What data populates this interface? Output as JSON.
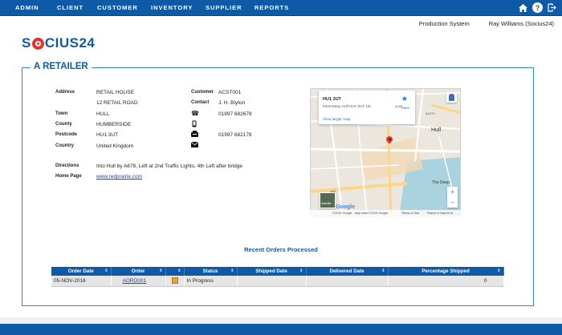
{
  "nav": {
    "items": [
      "ADMIN",
      "CLIENT",
      "CUSTOMER",
      "INVENTORY",
      "SUPPLIER",
      "REPORTS"
    ],
    "icons": [
      "home-icon",
      "help-icon",
      "logout-icon"
    ]
  },
  "header": {
    "system": "Production System",
    "user": "Ray Williams (Socius24)"
  },
  "logo": {
    "text_prefix": "S",
    "text_suffix": "CIUS24"
  },
  "panel": {
    "title": "A RETAILER",
    "address_label": "Address",
    "address_line1": "RETAIL HOUSE",
    "address_line2": "12 RETAIL ROAD",
    "town_label": "Town",
    "town": "HULL",
    "county_label": "County",
    "county": "HUMBERSIDE",
    "postcode_label": "Postcode",
    "postcode": "HU1 3UT",
    "country_label": "Country",
    "country": "United Kingdom",
    "customer_label": "Customer",
    "customer": "ACST001",
    "contact_label": "Contact",
    "contact": "J. H. Blyton",
    "phone": "01997 682678",
    "mobile": "",
    "fax": "01997 682178",
    "email": "",
    "directions_label": "Directions",
    "directions": "Into Hull by A678, Left at 2nd Traffic Lights, 4th Left after bridge",
    "homepage_label": "Home Page",
    "homepage": "www.redprairie.com"
  },
  "map": {
    "card_title": "HU1 3UT",
    "card_subtitle": "Ferensway, Hull HU1 3UT, UK",
    "card_link": "View larger map",
    "save": "Save",
    "label_hull": "Hull",
    "label_deep": "The Deep",
    "road_a63": "A63",
    "road_a1079": "A1079",
    "road_a165": "A165",
    "footer_data": "©2016 Google - Map data ©2016 Google",
    "footer_terms": "Terms of Use",
    "footer_report": "Report a map error",
    "google": "Google",
    "sat_label": "Satellite",
    "zoom_in": "+",
    "zoom_out": "−"
  },
  "orders": {
    "title": "Recent Orders Processed",
    "columns": [
      "Order Date",
      "Order",
      "",
      "Status",
      "Shipped Date",
      "Delivered Date",
      "Percentage Shipped"
    ],
    "rows": [
      {
        "order_date": "05-NOV-2016",
        "order": "AORD001",
        "status": "In Progress",
        "shipped": "",
        "delivered": "",
        "pct": "0"
      }
    ]
  }
}
